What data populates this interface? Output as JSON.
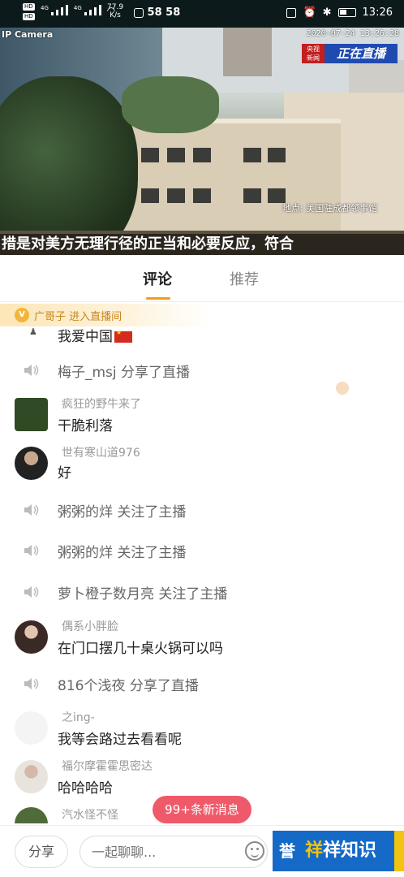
{
  "statusbar": {
    "hd1": "HD",
    "hd2": "HD",
    "net1": "4G",
    "net2": "4G",
    "speed_value": "77.9",
    "speed_unit": "K/s",
    "nums": "58 58",
    "time": "13:26"
  },
  "video": {
    "camera_label": "IP Camera",
    "timestamp": "2020-07-24 13:26:28",
    "channel_top": "央视",
    "channel_bottom": "新闻",
    "live_badge": "正在直播",
    "location": "地点: 美国驻成都领事馆",
    "subtitle": "措是对美方无理行径的正当和必要反应，符合"
  },
  "tabs": [
    {
      "label": "评论"
    },
    {
      "label": "推荐"
    }
  ],
  "join_banner": {
    "badge": "V",
    "text": "广哥子 进入直播间"
  },
  "comments": [
    {
      "type": "user",
      "name": "",
      "text": "我爱中国",
      "partial": true
    },
    {
      "type": "system",
      "text": "梅子_msj 分享了直播"
    },
    {
      "type": "user",
      "name": "疯狂的野牛来了",
      "text": "干脆利落",
      "avatar": "green"
    },
    {
      "type": "user",
      "name": "世有寒山道976",
      "text": "好",
      "avatar": "dark"
    },
    {
      "type": "system",
      "text": "粥粥的烊 关注了主播"
    },
    {
      "type": "system",
      "text": "粥粥的烊 关注了主播"
    },
    {
      "type": "system",
      "text": "萝卜橙子数月亮 关注了主播"
    },
    {
      "type": "user",
      "name": "偶系小胖脸",
      "text": "在门口摆几十桌火锅可以吗",
      "avatar": "dark"
    },
    {
      "type": "system",
      "text": "816个浅夜 分享了直播"
    },
    {
      "type": "user",
      "name": "之ing-",
      "text": "我等会路过去看看呢",
      "avatar": "blank"
    },
    {
      "type": "user",
      "name": "福尔摩霍霍思密达",
      "text": "哈哈哈哈",
      "avatar": "light"
    },
    {
      "type": "user",
      "name": "汽水怪不怪",
      "text": "",
      "avatar": "green"
    }
  ],
  "new_messages": "99+条新消息",
  "bottom": {
    "share_label": "分享",
    "chat_placeholder": "一起聊聊..."
  },
  "watermark": {
    "icon_char": "誉",
    "text_highlight": "祥",
    "text_rest": "祥知识"
  },
  "colors": {
    "accent": "#f39c12",
    "new_msg_bg": "#ef5a6a",
    "join_text": "#c8861c"
  }
}
